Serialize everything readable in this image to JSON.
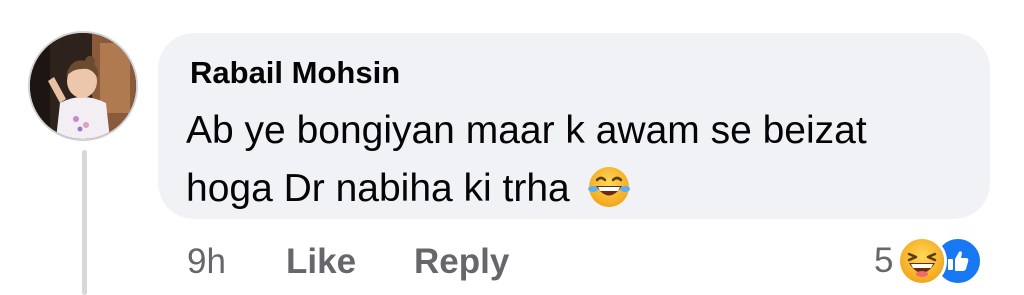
{
  "comment": {
    "author": "Rabail Mohsin",
    "text_line1": "Ab ye bongiyan maar k awam se beizat",
    "text_line2": "hoga Dr nabiha ki trha",
    "inline_emoji": "laughing-crying-emoji"
  },
  "actions": {
    "time": "9h",
    "like_label": "Like",
    "reply_label": "Reply"
  },
  "reactions": {
    "count": "5",
    "icons": [
      "haha-reaction-icon",
      "like-reaction-icon"
    ]
  },
  "colors": {
    "bubble_bg": "#f0f2f5",
    "text": "#050505",
    "muted": "#65676b",
    "like_blue": "#1877f2",
    "emoji_yellow": "#f7b125",
    "thread_line": "#d6d8dc"
  }
}
